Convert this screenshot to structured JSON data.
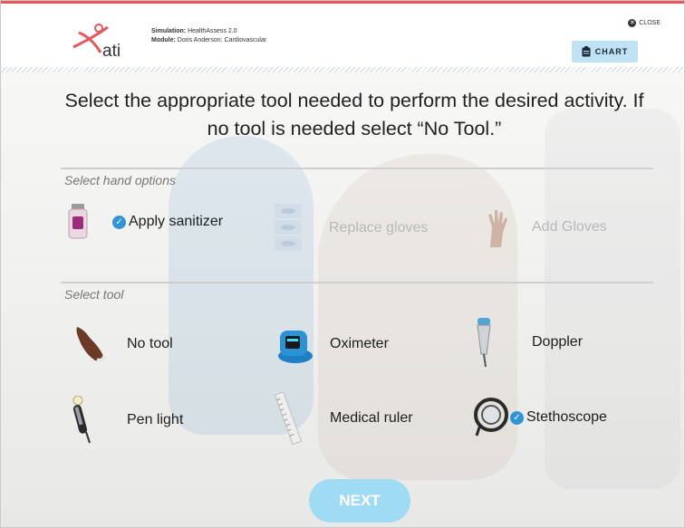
{
  "header": {
    "logo_text": "ati",
    "simulation_label": "Simulation:",
    "simulation_value": "HealthAssess 2.0",
    "module_label": "Module:",
    "module_value": "Doris Anderson: Cardiovascular",
    "close_label": "CLOSE",
    "chart_label": "CHART"
  },
  "instructions": "Select the appropriate tool needed to perform the desired activity. If no tool is needed select “No Tool.”",
  "hand_section": {
    "label": "Select hand options",
    "options": [
      {
        "label": "Apply sanitizer",
        "selected": true,
        "enabled": true
      },
      {
        "label": "Replace gloves",
        "selected": false,
        "enabled": false
      },
      {
        "label": "Add Gloves",
        "selected": false,
        "enabled": false
      }
    ]
  },
  "tool_section": {
    "label": "Select tool",
    "options": [
      {
        "label": "No tool",
        "selected": false
      },
      {
        "label": "Oximeter",
        "selected": false
      },
      {
        "label": "Doppler",
        "selected": false
      },
      {
        "label": "Pen light",
        "selected": false
      },
      {
        "label": "Medical ruler",
        "selected": false
      },
      {
        "label": "Stethoscope",
        "selected": true
      }
    ]
  },
  "next_label": "NEXT",
  "colors": {
    "accent_red": "#e8555a",
    "check_blue": "#2f95d8",
    "chart_button": "#bfe3f4",
    "next_button": "#9fdcf3"
  }
}
